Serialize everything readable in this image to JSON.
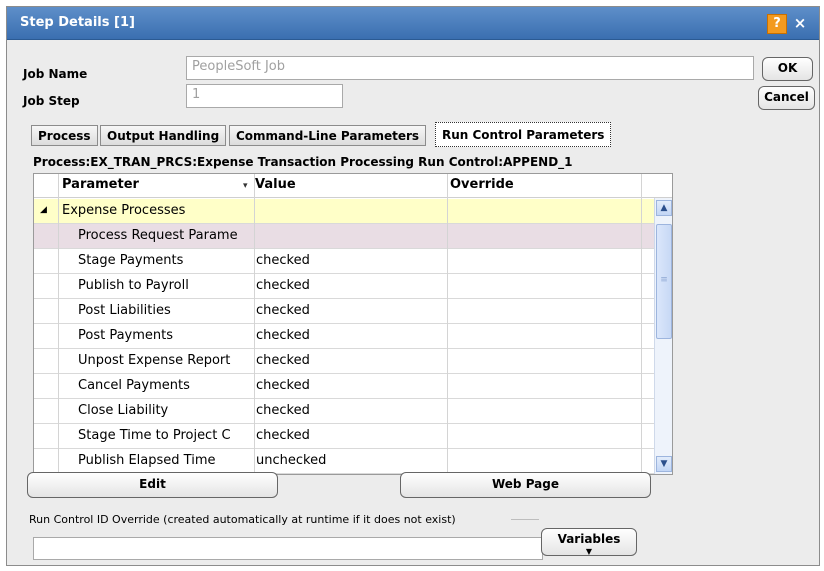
{
  "window": {
    "title": "Step Details [1]",
    "help_label": "?",
    "close_label": "×"
  },
  "form": {
    "job_name_label": "Job Name",
    "job_name_value": "PeopleSoft Job",
    "job_step_label": "Job Step",
    "job_step_value": "1",
    "ok_label": "OK",
    "cancel_label": "Cancel"
  },
  "tabs": [
    {
      "label": "Process",
      "active": false
    },
    {
      "label": "Output Handling",
      "active": false
    },
    {
      "label": "Command-Line Parameters",
      "active": false
    },
    {
      "label": "Run Control Parameters",
      "active": true
    }
  ],
  "process_line": "Process:EX_TRAN_PRCS:Expense Transaction Processing Run Control:APPEND_1",
  "grid": {
    "columns": [
      "Parameter",
      "Value",
      "Override"
    ],
    "group_label": "Expense Processes",
    "rows": [
      {
        "parameter": "Process Request Parame",
        "value": "",
        "override": "",
        "highlight": true
      },
      {
        "parameter": "Stage Payments",
        "value": "checked",
        "override": ""
      },
      {
        "parameter": "Publish to Payroll",
        "value": "checked",
        "override": ""
      },
      {
        "parameter": "Post Liabilities",
        "value": "checked",
        "override": ""
      },
      {
        "parameter": "Post Payments",
        "value": "checked",
        "override": ""
      },
      {
        "parameter": "Unpost Expense Report",
        "value": "checked",
        "override": ""
      },
      {
        "parameter": "Cancel Payments",
        "value": "checked",
        "override": ""
      },
      {
        "parameter": "Close Liability",
        "value": "checked",
        "override": ""
      },
      {
        "parameter": "Stage Time to Project C",
        "value": "checked",
        "override": ""
      },
      {
        "parameter": "Publish Elapsed Time",
        "value": "unchecked",
        "override": ""
      }
    ]
  },
  "buttons": {
    "edit_label": "Edit",
    "web_page_label": "Web Page",
    "variables_label": "Variables"
  },
  "run_control_override_label": "Run Control ID Override (created automatically at runtime if it does not exist)",
  "run_control_override_value": "",
  "colors": {
    "titlebar": "#3a6fb0",
    "group_row": "#ffffc8",
    "highlight_row": "#e9dde4",
    "help_button": "#f39a1f"
  }
}
